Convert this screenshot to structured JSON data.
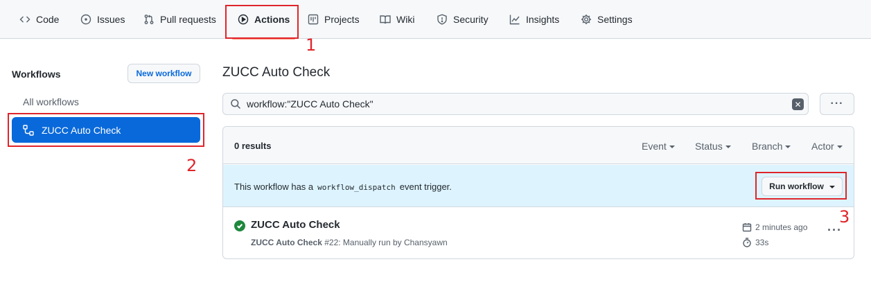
{
  "nav": {
    "tabs": [
      {
        "label": "Code",
        "icon": "code-icon"
      },
      {
        "label": "Issues",
        "icon": "issue-icon"
      },
      {
        "label": "Pull requests",
        "icon": "pull-request-icon"
      },
      {
        "label": "Actions",
        "icon": "play-icon",
        "active": true
      },
      {
        "label": "Projects",
        "icon": "project-icon"
      },
      {
        "label": "Wiki",
        "icon": "book-icon"
      },
      {
        "label": "Security",
        "icon": "shield-icon"
      },
      {
        "label": "Insights",
        "icon": "graph-icon"
      },
      {
        "label": "Settings",
        "icon": "gear-icon"
      }
    ]
  },
  "annotations": [
    "1",
    "2",
    "3"
  ],
  "sidebar": {
    "title": "Workflows",
    "new_workflow": "New workflow",
    "all_workflows": "All workflows",
    "active_workflow": "ZUCC Auto Check"
  },
  "main": {
    "title": "ZUCC Auto Check",
    "search_value": "workflow:\"ZUCC Auto Check\"",
    "results": "0 results",
    "filters": [
      "Event",
      "Status",
      "Branch",
      "Actor"
    ],
    "banner": {
      "prefix": "This workflow has a",
      "code": "workflow_dispatch",
      "suffix": "event trigger."
    },
    "run_workflow": "Run workflow",
    "run": {
      "title": "ZUCC Auto Check",
      "workflow_name": "ZUCC Auto Check",
      "detail": "#22: Manually run by Chansyawn",
      "time": "2 minutes ago",
      "duration": "33s"
    }
  },
  "colors": {
    "accent": "#0969da",
    "success": "#1f883d",
    "annotation_red": "#e0242a",
    "active_tab_underline": "#fd8c73",
    "banner_bg": "#ddf4ff"
  }
}
